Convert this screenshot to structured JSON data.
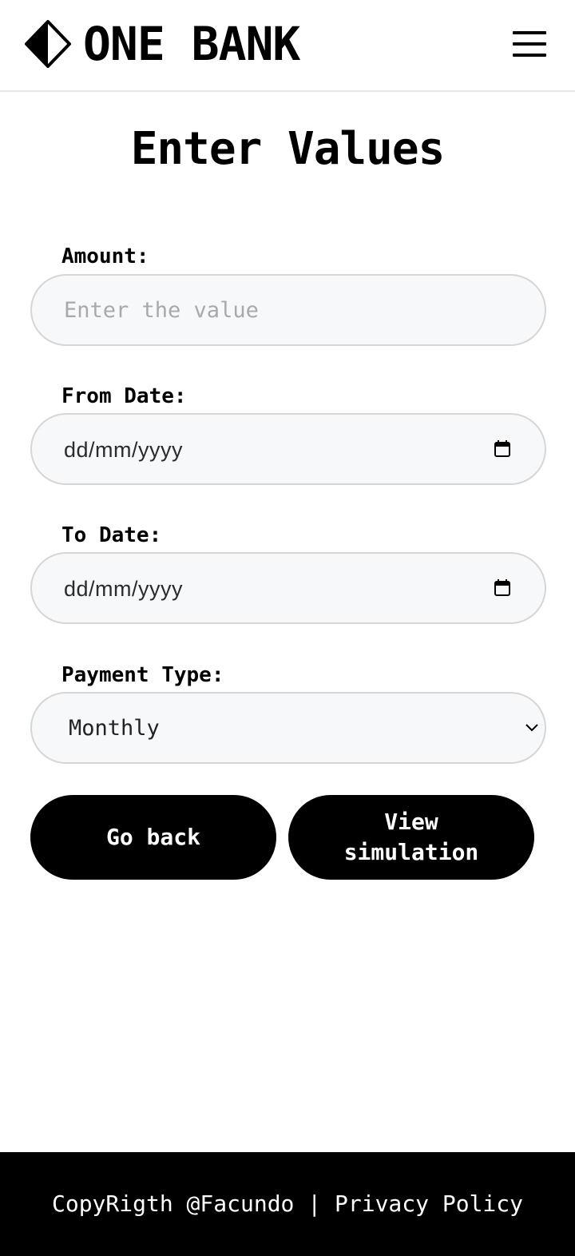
{
  "header": {
    "brand": "ONE BANK",
    "logo_icon": "diamond-logo-icon",
    "menu_icon": "hamburger-menu-icon"
  },
  "main": {
    "title": "Enter Values",
    "amount": {
      "label": "Amount:",
      "placeholder": "Enter the value",
      "value": ""
    },
    "from_date": {
      "label": "From Date:",
      "placeholder": "dd/mm/yyyy",
      "icon": "calendar-icon"
    },
    "to_date": {
      "label": "To Date:",
      "placeholder": "dd/mm/yyyy",
      "icon": "calendar-icon"
    },
    "payment_type": {
      "label": "Payment Type:",
      "selected": "Monthly",
      "icon": "chevron-down-icon"
    },
    "buttons": {
      "back": "Go back",
      "simulation": "View simulation"
    }
  },
  "footer": {
    "copyright": "CopyRigth @Facundo",
    "separator": " | ",
    "privacy": "Privacy Policy"
  },
  "colors": {
    "primary": "#000000",
    "background": "#ffffff",
    "field_background": "#f7f8fa",
    "field_border": "#d6d6d6",
    "placeholder": "#a9a9a9"
  }
}
